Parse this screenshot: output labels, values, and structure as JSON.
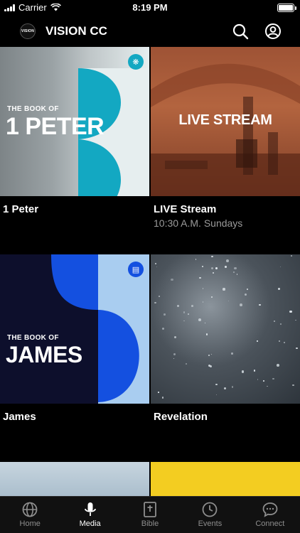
{
  "status": {
    "carrier": "Carrier",
    "time": "8:19 PM",
    "battery_level": 1.0
  },
  "header": {
    "logo_text": "VISION",
    "title": "VISION CC",
    "icons": [
      "search-icon",
      "account-icon"
    ]
  },
  "media": [
    {
      "title": "1 Peter",
      "subtitle": "",
      "art": {
        "kicker": "THE BOOK OF",
        "headline": "1 PETER",
        "badge_icon": "emblem-icon",
        "colors": [
          "#13a8c2",
          "#e6eeef"
        ]
      }
    },
    {
      "title": "LIVE Stream",
      "subtitle": "10:30 A.M. Sundays",
      "art": {
        "headline": "LIVE STREAM",
        "colors": [
          "#b3643f"
        ]
      }
    },
    {
      "title": "James",
      "subtitle": "",
      "art": {
        "kicker": "THE BOOK OF",
        "headline": "JAMES",
        "badge_icon": "book-icon",
        "colors": [
          "#0d0f2c",
          "#1450e0",
          "#a9cdf0"
        ]
      }
    },
    {
      "title": "Revelation",
      "subtitle": "",
      "art": {
        "colors": [
          "#4b535b"
        ]
      }
    }
  ],
  "tabs": [
    {
      "label": "Home",
      "icon": "globe-icon",
      "active": false
    },
    {
      "label": "Media",
      "icon": "microphone-icon",
      "active": true
    },
    {
      "label": "Bible",
      "icon": "bible-icon",
      "active": false
    },
    {
      "label": "Events",
      "icon": "clock-icon",
      "active": false
    },
    {
      "label": "Connect",
      "icon": "chat-icon",
      "active": false
    }
  ]
}
